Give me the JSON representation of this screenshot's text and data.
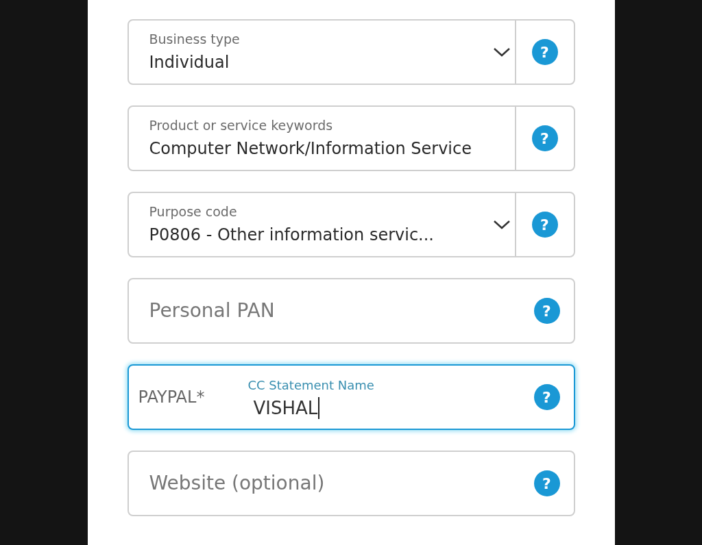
{
  "fields": [
    {
      "kind": "select",
      "label": "Business type",
      "value": "Individual",
      "focused": false,
      "help": "?"
    },
    {
      "kind": "text",
      "label": "Product or service keywords",
      "value": "Computer Network/Information Service",
      "focused": false,
      "help": "?"
    },
    {
      "kind": "select",
      "label": "Purpose code",
      "value": "P0806 - Other information servic...",
      "focused": false,
      "help": "?"
    },
    {
      "kind": "input",
      "label": "Personal PAN",
      "focused": false,
      "help": "?"
    },
    {
      "kind": "prefixed",
      "prefix": "PAYPAL*",
      "label": "CC Statement Name",
      "value": "VISHAL",
      "focused": true,
      "help": "?"
    },
    {
      "kind": "input",
      "placeholder": "Website (optional)",
      "focused": false,
      "help": "?"
    }
  ]
}
